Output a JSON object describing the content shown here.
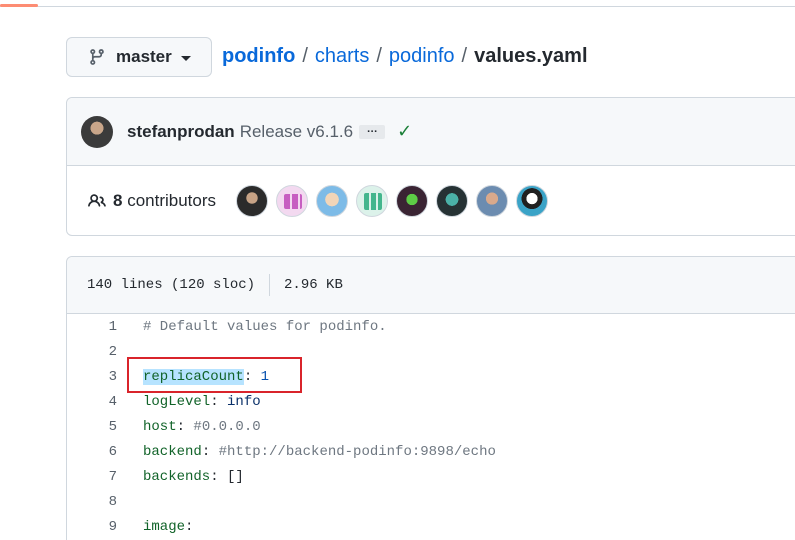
{
  "branch": {
    "name": "master"
  },
  "breadcrumb": {
    "repo": "podinfo",
    "segments": [
      "charts",
      "podinfo"
    ],
    "separator": "/",
    "file": "values.yaml"
  },
  "commit": {
    "author": "stefanprodan",
    "message": "Release v6.1.6",
    "ellipsis": "…",
    "status": "✓"
  },
  "contributors": {
    "count": "8",
    "label": "contributors"
  },
  "file_info": {
    "lines": "140 lines (120 sloc)",
    "size": "2.96 KB"
  },
  "code_lines": [
    {
      "n": "1",
      "comment": "# Default values for podinfo."
    },
    {
      "n": "2"
    },
    {
      "n": "3",
      "key": "replicaCount",
      "value": "1"
    },
    {
      "n": "4",
      "key": "logLevel",
      "value": "info"
    },
    {
      "n": "5",
      "key": "host",
      "value": "#0.0.0.0"
    },
    {
      "n": "6",
      "key": "backend",
      "value": "#http://backend-podinfo:9898/echo"
    },
    {
      "n": "7",
      "key": "backends",
      "value": "[]"
    },
    {
      "n": "8"
    },
    {
      "n": "9",
      "key": "image",
      "value": ""
    }
  ],
  "colors": {
    "link": "#0969da",
    "highlight": "#b6e3ff",
    "annotation_box": "#d9242b",
    "success": "#1a7f37"
  }
}
